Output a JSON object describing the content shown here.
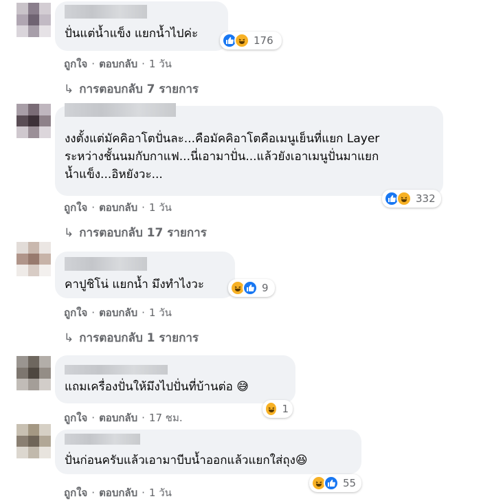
{
  "comments": [
    {
      "text": "ปั่นแต่น้ำแข็ง แยกน้ำไปค่ะ",
      "reaction_count": "176",
      "reactions": [
        "like",
        "haha"
      ],
      "meta": {
        "like": "ถูกใจ",
        "reply": "ตอบกลับ",
        "time": "1 วัน"
      },
      "replies": "การตอบกลับ 7 รายการ"
    },
    {
      "text": "งงตั้งแต่มัคคิอาโตปั่นละ...คือมัคคิอาโตคือเมนูเย็นที่แยก Layer\nระหว่างชั้นนมกับกาแฟ...นี่เอามาปั่น...แล้วยังเอาเมนูปั่นมาแยก\nน้ำแข็ง...อิหยังวะ...",
      "reaction_count": "332",
      "reactions": [
        "like",
        "haha"
      ],
      "meta": {
        "like": "ถูกใจ",
        "reply": "ตอบกลับ",
        "time": "1 วัน"
      },
      "replies": "การตอบกลับ 17 รายการ"
    },
    {
      "text": "คาปูชิโน่ แยกน้ำ มึงทำไงวะ",
      "reaction_count": "9",
      "reactions": [
        "haha",
        "like"
      ],
      "meta": {
        "like": "ถูกใจ",
        "reply": "ตอบกลับ",
        "time": "1 วัน"
      },
      "replies": "การตอบกลับ 1 รายการ"
    },
    {
      "text": "แถมเครื่องปั่นให้มึงไปปั่นที่บ้านต่อ 😅",
      "reaction_count": "1",
      "reactions": [
        "haha"
      ],
      "meta": {
        "like": "ถูกใจ",
        "reply": "ตอบกลับ",
        "time": "17 ชม."
      }
    },
    {
      "text": "ปั่นก่อนครับแล้วเอามาบีบน้ำออกแล้วแยกใส่ถุง😆",
      "reaction_count": "55",
      "reactions": [
        "haha",
        "like"
      ],
      "meta": {
        "like": "ถูกใจ",
        "reply": "ตอบกลับ",
        "time": "1 วัน"
      }
    }
  ],
  "colors": {
    "bubble": "#f0f2f5",
    "meta": "#65676b",
    "like": "#1877f2",
    "haha": "#f7b125"
  },
  "icons": {
    "reply_arrow": "↳",
    "like": "thumbs-up-icon",
    "haha": "laughing-face-icon"
  }
}
